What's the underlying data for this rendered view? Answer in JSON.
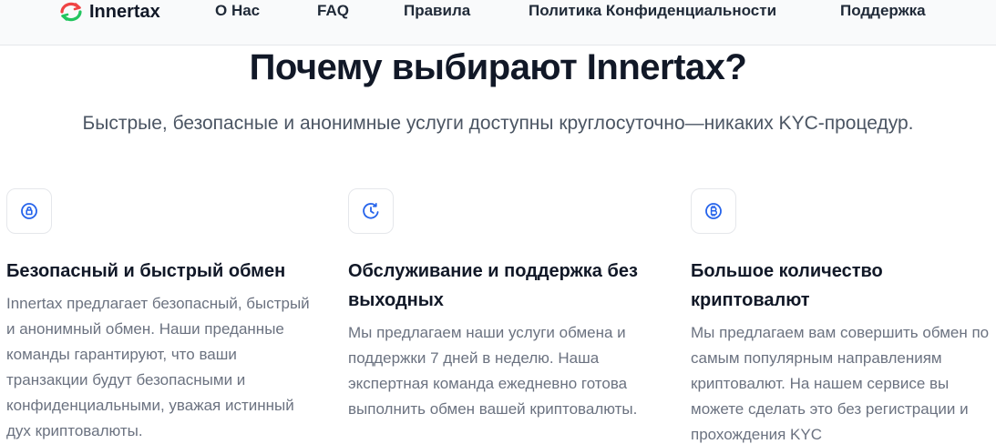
{
  "brand": {
    "name": "Innertax",
    "logo_icon": "refresh-arrows-icon",
    "accent": "#ef4444",
    "accent2": "#22c55e"
  },
  "nav": {
    "items": [
      {
        "label": "О Нас"
      },
      {
        "label": "FAQ"
      },
      {
        "label": "Правила"
      },
      {
        "label": "Политика Конфиденциальности"
      },
      {
        "label": "Поддержка"
      }
    ]
  },
  "hero": {
    "title": "Почему выбирают Innertax?",
    "subtitle": "Быстрые, безопасные и анонимные услуги доступны круглосуточно—никаких KYC-процедур."
  },
  "features": [
    {
      "icon": "lock-icon",
      "title": "Безопасный и быстрый обмен",
      "text": "Innertax предлагает безопасный, быстрый и анонимный обмен. Наши преданные команды гарантируют, что ваши транзакции будут безопасными и конфиденциальными, уважая истинный дух криптовалюты."
    },
    {
      "icon": "clock-icon",
      "title": "Обслуживание и поддержка без выходных",
      "text": "Мы предлагаем наши услуги обмена и поддержки 7 дней в неделю. Наша экспертная команда ежедневно готова выполнить обмен вашей криптовалюты."
    },
    {
      "icon": "bitcoin-icon",
      "title": "Большое количество криптовалют",
      "text": "Мы предлагаем вам совершить обмен по самым популярным направлениям криптовалют. На нашем сервисе вы можете сделать это без регистрации и прохождения KYC"
    }
  ],
  "colors": {
    "icon_blue": "#2563eb"
  }
}
